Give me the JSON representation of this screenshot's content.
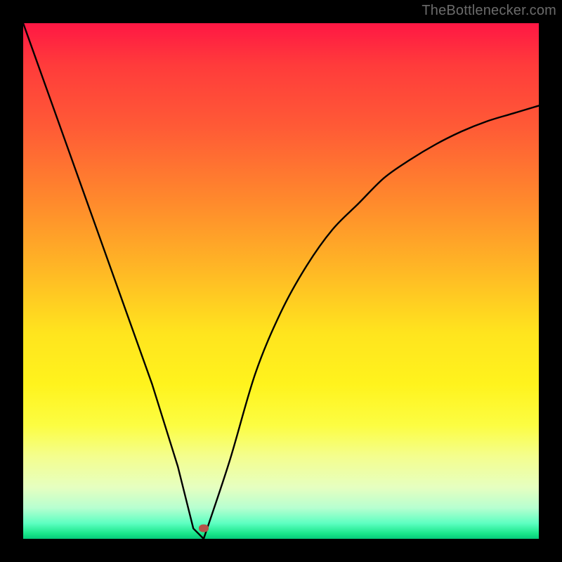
{
  "watermark": "TheBottlenecker.com",
  "chart_data": {
    "type": "line",
    "title": "",
    "xlabel": "",
    "ylabel": "",
    "xlim": [
      0,
      100
    ],
    "ylim": [
      0,
      100
    ],
    "grid": false,
    "series": [
      {
        "name": "bottleneck-curve",
        "x": [
          0,
          5,
          10,
          15,
          20,
          25,
          30,
          33,
          35,
          40,
          45,
          50,
          55,
          60,
          65,
          70,
          75,
          80,
          85,
          90,
          95,
          100
        ],
        "y": [
          100,
          86,
          72,
          58,
          44,
          30,
          14,
          2,
          0,
          15,
          32,
          44,
          53,
          60,
          65,
          70,
          73.5,
          76.5,
          79,
          81,
          82.5,
          84
        ]
      }
    ],
    "marker_point": {
      "x": 35,
      "y": 2
    },
    "colors": {
      "line": "#000000",
      "marker": "#b5524a",
      "gradient_top": "#ff1744",
      "gradient_bottom": "#06c97a"
    }
  }
}
